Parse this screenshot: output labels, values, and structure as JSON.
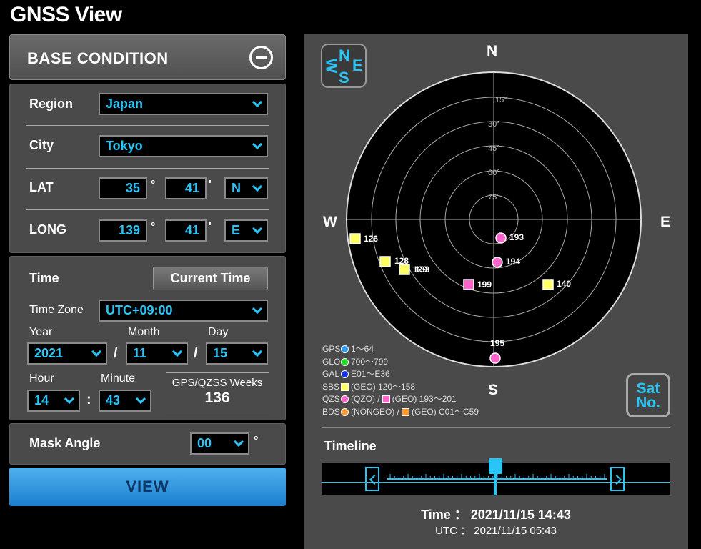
{
  "app": {
    "title": "GNSS View"
  },
  "base_condition": {
    "title": "BASE CONDITION",
    "region_label": "Region",
    "region_value": "Japan",
    "city_label": "City",
    "city_value": "Tokyo",
    "lat_label": "LAT",
    "lat_deg": "35",
    "lat_min": "41",
    "lat_dir": "N",
    "long_label": "LONG",
    "long_deg": "139",
    "long_min": "41",
    "long_dir": "E",
    "deg_mark": "°",
    "min_mark": "'"
  },
  "time": {
    "label": "Time",
    "current_time_button": "Current Time",
    "timezone_label": "Time Zone",
    "timezone_value": "UTC+09:00",
    "year_label": "Year",
    "year_value": "2021",
    "month_label": "Month",
    "month_value": "11",
    "day_label": "Day",
    "day_value": "15",
    "date_sep": "/",
    "hour_label": "Hour",
    "hour_value": "14",
    "minute_label": "Minute",
    "minute_value": "43",
    "time_sep": ":",
    "weeks_label": "GPS/QZSS Weeks",
    "weeks_value": "136"
  },
  "mask": {
    "label": "Mask Angle",
    "value": "00",
    "unit": "°"
  },
  "view_button": "VIEW",
  "skyplot": {
    "compass": {
      "n": "N",
      "w": "W",
      "s": "S",
      "e": "E"
    },
    "directions": {
      "n": "N",
      "s": "S",
      "w": "W",
      "e": "E"
    },
    "elevation_labels": [
      "15°",
      "30°",
      "45°",
      "60°",
      "75°"
    ],
    "satellites": [
      {
        "id": "126",
        "type": "sbs",
        "color": "#ffff66"
      },
      {
        "id": "128",
        "type": "sbs",
        "color": "#ffff66"
      },
      {
        "id": "129",
        "type": "sbs",
        "color": "#ffff66"
      },
      {
        "id": "133",
        "type": "sbs",
        "color": "#ffff66"
      },
      {
        "id": "140",
        "type": "sbs",
        "color": "#ffff66"
      },
      {
        "id": "193",
        "type": "qzo",
        "color": "#ff66cc"
      },
      {
        "id": "194",
        "type": "qzo",
        "color": "#ff66cc"
      },
      {
        "id": "195",
        "type": "qzo",
        "color": "#ff66cc"
      },
      {
        "id": "199",
        "type": "qzs-geo",
        "color": "#ff66cc"
      }
    ],
    "legend": [
      {
        "code": "GPS",
        "text": "1～64",
        "color": "#2e9ff0"
      },
      {
        "code": "GLO",
        "text": "700～799",
        "color": "#22dd22"
      },
      {
        "code": "GAL",
        "text": "E01～E36",
        "color": "#1533e0"
      },
      {
        "code": "SBS",
        "text": "(GEO) 120～158",
        "color": "#ffff66"
      },
      {
        "code": "QZS",
        "text_a": "(QZO) /",
        "text_b": "(GEO) 193～201",
        "color": "#ff66cc"
      },
      {
        "code": "BDS",
        "text_a": "(NONGEO) /",
        "text_b": "(GEO) C01～C59",
        "color": "#ff9933"
      }
    ],
    "sat_no_button": [
      "Sat",
      "No."
    ]
  },
  "timeline": {
    "label": "Timeline",
    "time_line": "Time ： 2021/11/15 14:43",
    "utc_line": "UTC ： 2021/11/15 05:43"
  }
}
